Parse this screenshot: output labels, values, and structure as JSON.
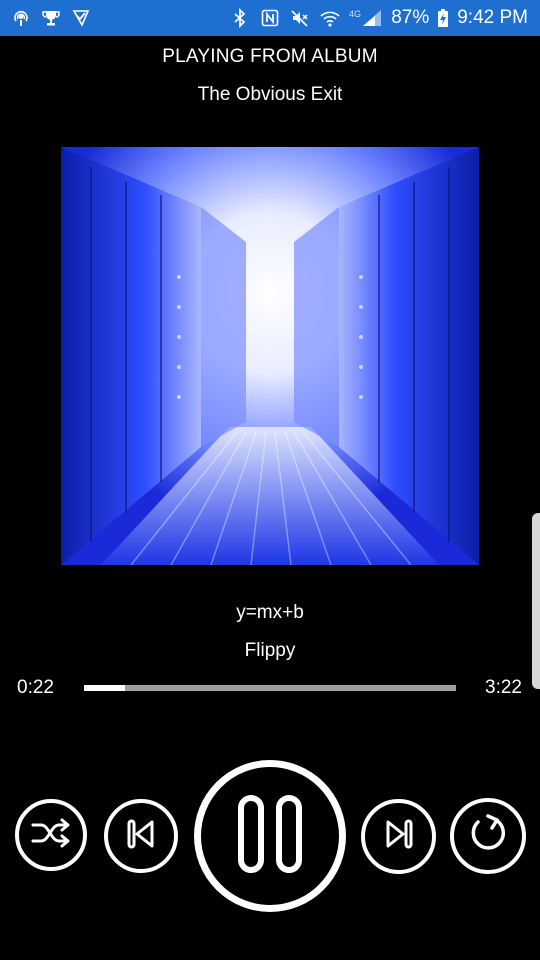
{
  "status_bar": {
    "left_icons": [
      "podcast-icon",
      "trophy-icon",
      "check-app-icon"
    ],
    "right_icons": [
      "bluetooth-icon",
      "nfc-icon",
      "mute-icon",
      "wifi-icon",
      "lte-signal-icon",
      "battery-charging-icon"
    ],
    "network_label": "4G",
    "battery": "87%",
    "time": "9:42 PM",
    "background": "#1e6fd0"
  },
  "header": {
    "context_label": "PLAYING FROM ALBUM",
    "album_name": "The Obvious Exit"
  },
  "album_art": {
    "description_icon": "album-cover-image",
    "dominant_color": "#1a3cff"
  },
  "track": {
    "title": "y=mx+b",
    "artist": "Flippy"
  },
  "progress": {
    "elapsed": "0:22",
    "total": "3:22",
    "fraction": 0.11
  },
  "controls": {
    "shuffle_icon": "shuffle-icon",
    "previous_icon": "skip-previous-icon",
    "play_pause_icon": "pause-icon",
    "next_icon": "skip-next-icon",
    "repeat_icon": "repeat-icon"
  }
}
